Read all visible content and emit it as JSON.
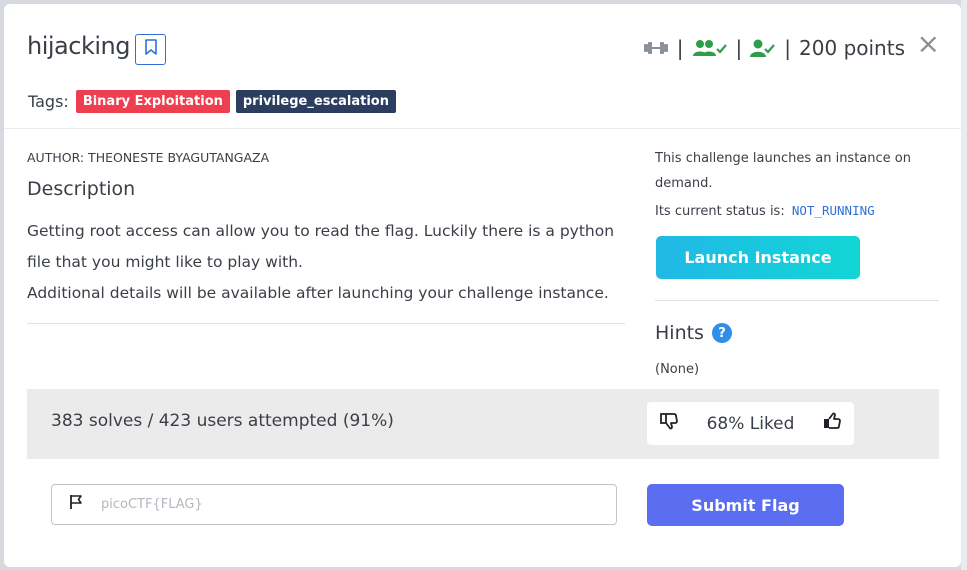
{
  "challenge": {
    "title": "hijacking",
    "points_label": "200 points",
    "close_glyph": "×",
    "tags_label": "Tags:",
    "tags": [
      {
        "label": "Binary Exploitation",
        "color": "#ef3e4f"
      },
      {
        "label": "privilege_escalation",
        "color": "#2c3e5f"
      }
    ],
    "author": "AUTHOR: THEONESTE BYAGUTANGAZA",
    "description_title": "Description",
    "description_lines": [
      "Getting root access can allow you to read the flag. Luckily there is a python file that you might like to play with.",
      "Additional details will be available after launching your challenge instance."
    ]
  },
  "meta_icons": [
    {
      "name": "dumbbell-icon",
      "color": "#8a9099"
    },
    {
      "name": "users-check-icon",
      "color": "#2e9e4a"
    },
    {
      "name": "user-check-icon",
      "color": "#2e9e4a"
    }
  ],
  "instance": {
    "description": "This challenge launches an instance on demand.",
    "status_prefix": "Its current status is:",
    "status_value": "NOT_RUNNING",
    "launch_label": "Launch Instance"
  },
  "hints": {
    "title": "Hints",
    "help_glyph": "?",
    "content": "(None)"
  },
  "stats": {
    "solves_text": "383 solves / 423 users attempted (91%)",
    "liked_text": "68% Liked"
  },
  "flag_form": {
    "placeholder": "picoCTF{FLAG}",
    "submit_label": "Submit Flag"
  },
  "colors": {
    "accent_blue": "#2f6fd6",
    "submit_purple": "#5b6df0",
    "launch_gradient_start": "#21b8e6",
    "launch_gradient_end": "#12d6d6"
  }
}
